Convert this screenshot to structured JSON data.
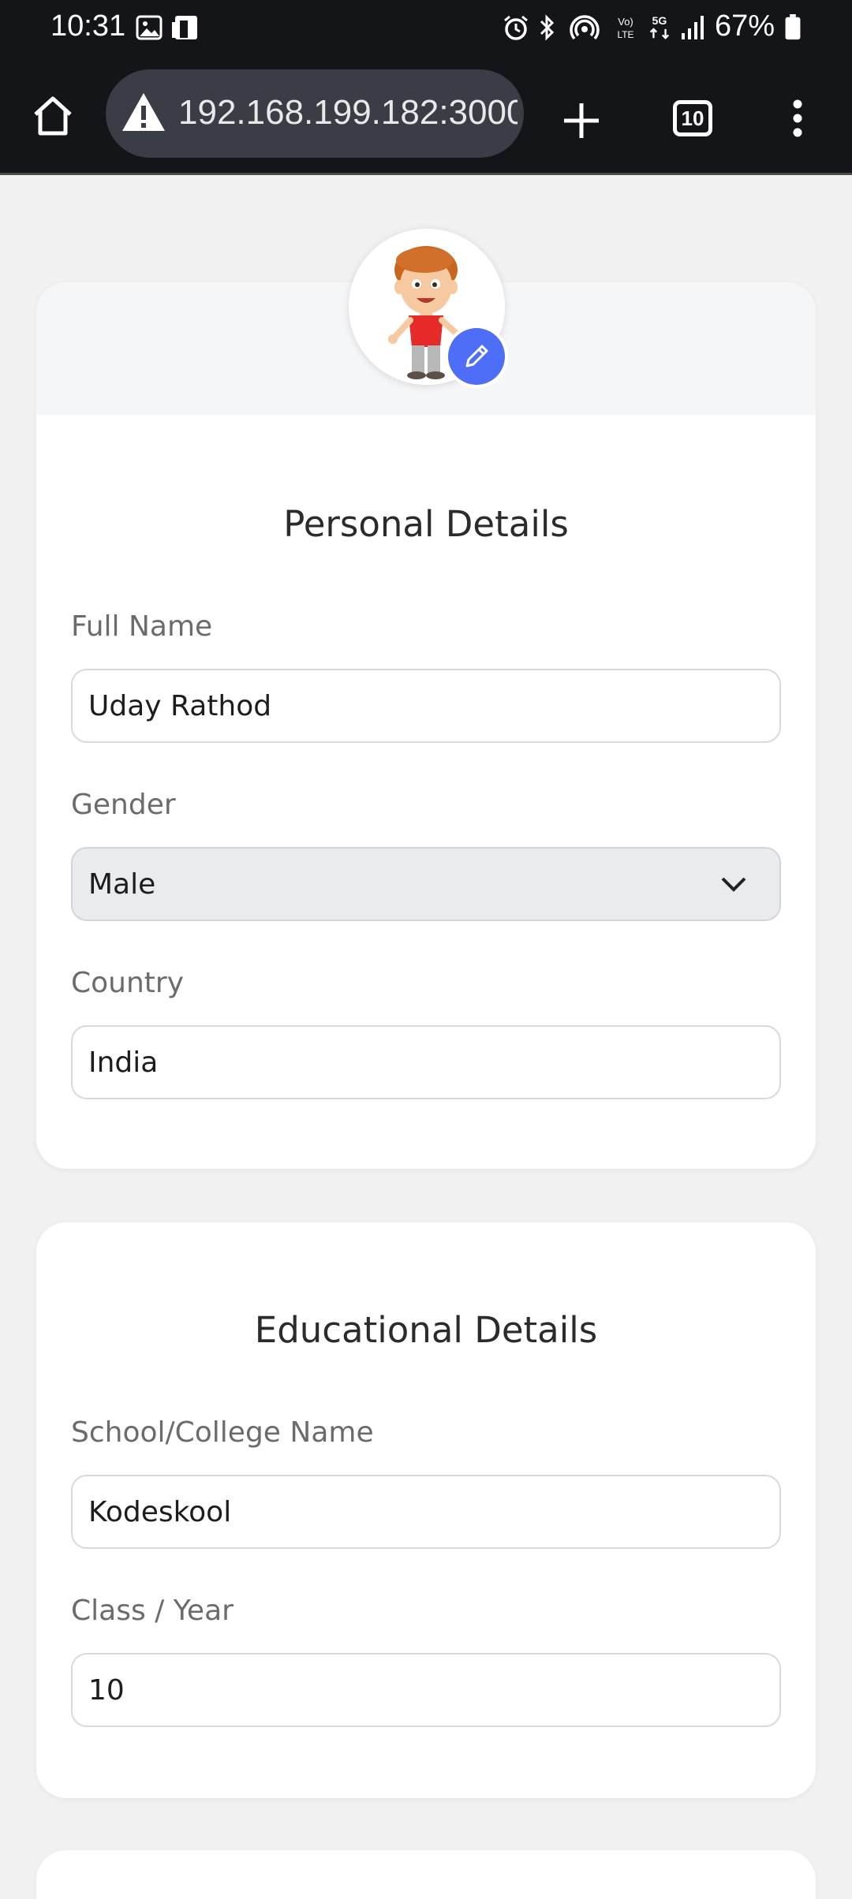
{
  "status_bar": {
    "time": "10:31",
    "battery": "67%",
    "icons": [
      "gallery-icon",
      "device-icon",
      "alarm-icon",
      "bluetooth-icon",
      "hotspot-icon",
      "volte-icon",
      "5g-icon",
      "signal-icon",
      "battery-icon"
    ],
    "volte_label": "Vo)\nLTE",
    "network_label": "5G"
  },
  "browser": {
    "url": "192.168.199.182:3000",
    "tab_count": "10",
    "icons": [
      "home-icon",
      "warning-icon",
      "plus-icon",
      "tabs-icon",
      "menu-icon"
    ]
  },
  "personal": {
    "title": "Personal Details",
    "full_name_label": "Full Name",
    "full_name_value": "Uday Rathod",
    "gender_label": "Gender",
    "gender_value": "Male",
    "country_label": "Country",
    "country_value": "India"
  },
  "educational": {
    "title": "Educational Details",
    "school_label": "School/College Name",
    "school_value": "Kodeskool",
    "class_label": "Class / Year",
    "class_value": "10"
  },
  "colors": {
    "accent": "#4f6ef7",
    "bar": "#141518",
    "page_bg": "#f1f1f1"
  }
}
